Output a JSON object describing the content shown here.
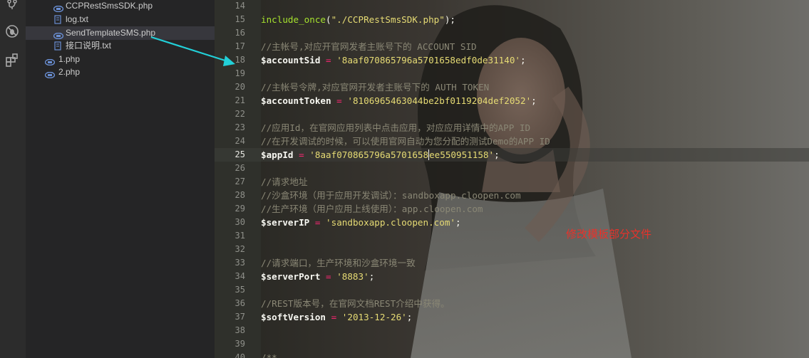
{
  "explorer": {
    "items": [
      {
        "label": "CCPRestSmsSDK.php",
        "icon": "php-file-icon",
        "selected": false
      },
      {
        "label": "log.txt",
        "icon": "text-file-icon",
        "selected": false
      },
      {
        "label": "SendTemplateSMS.php",
        "icon": "php-file-icon",
        "selected": true
      },
      {
        "label": "接口说明.txt",
        "icon": "text-file-icon",
        "selected": false
      },
      {
        "label": "1.php",
        "icon": "php-file-icon",
        "selected": false
      },
      {
        "label": "2.php",
        "icon": "php-file-icon",
        "selected": false
      }
    ]
  },
  "activity_bar": {
    "icons": [
      "source-control-icon",
      "debug-icon",
      "extensions-icon"
    ]
  },
  "editor": {
    "active_line": 25,
    "lines": [
      {
        "n": "14",
        "text": ""
      },
      {
        "n": "15",
        "tokens": [
          [
            "fn",
            "include_once"
          ],
          [
            "plain",
            "("
          ],
          [
            "str",
            "\"./CCPRestSmsSDK.php\""
          ],
          [
            "plain",
            ");"
          ]
        ]
      },
      {
        "n": "16",
        "text": ""
      },
      {
        "n": "17",
        "tokens": [
          [
            "cmt",
            "//主帐号,对应开官网发者主账号下的 ACCOUNT SID"
          ]
        ]
      },
      {
        "n": "18",
        "tokens": [
          [
            "var",
            "$accountSid"
          ],
          [
            "plain",
            " "
          ],
          [
            "op",
            "="
          ],
          [
            "plain",
            " "
          ],
          [
            "str",
            "'8aaf070865796a5701658edf0de31140'"
          ],
          [
            "plain",
            ";"
          ]
        ]
      },
      {
        "n": "19",
        "text": ""
      },
      {
        "n": "20",
        "tokens": [
          [
            "cmt",
            "//主帐号令牌,对应官网开发者主账号下的 AUTH TOKEN"
          ]
        ]
      },
      {
        "n": "21",
        "tokens": [
          [
            "var",
            "$accountToken"
          ],
          [
            "plain",
            " "
          ],
          [
            "op",
            "="
          ],
          [
            "plain",
            " "
          ],
          [
            "str",
            "'8106965463044be2bf0119204def2052'"
          ],
          [
            "plain",
            ";"
          ]
        ]
      },
      {
        "n": "22",
        "text": ""
      },
      {
        "n": "23",
        "tokens": [
          [
            "cmt",
            "//应用Id，在官网应用列表中点击应用，对应应用详情中的APP ID"
          ]
        ]
      },
      {
        "n": "24",
        "tokens": [
          [
            "cmt",
            "//在开发调试的时候，可以使用官网自动为您分配的测试Demo的APP ID"
          ]
        ]
      },
      {
        "n": "25",
        "tokens": [
          [
            "var",
            "$appId"
          ],
          [
            "plain",
            " "
          ],
          [
            "op",
            "="
          ],
          [
            "plain",
            " "
          ],
          [
            "str",
            "'8aaf070865796a5701658"
          ],
          [
            "caret",
            ""
          ],
          [
            "str",
            "ee550951158'"
          ],
          [
            "plain",
            ";"
          ]
        ]
      },
      {
        "n": "26",
        "text": ""
      },
      {
        "n": "27",
        "tokens": [
          [
            "cmt",
            "//请求地址"
          ]
        ]
      },
      {
        "n": "28",
        "tokens": [
          [
            "cmt",
            "//沙盒环境（用于应用开发调试）：sandboxapp.cloopen.com"
          ]
        ]
      },
      {
        "n": "29",
        "tokens": [
          [
            "cmt",
            "//生产环境（用户应用上线使用）：app.cloopen.com"
          ]
        ]
      },
      {
        "n": "30",
        "tokens": [
          [
            "var",
            "$serverIP"
          ],
          [
            "plain",
            " "
          ],
          [
            "op",
            "="
          ],
          [
            "plain",
            " "
          ],
          [
            "str",
            "'sandboxapp.cloopen.com'"
          ],
          [
            "plain",
            ";"
          ]
        ]
      },
      {
        "n": "31",
        "text": ""
      },
      {
        "n": "32",
        "text": ""
      },
      {
        "n": "33",
        "tokens": [
          [
            "cmt",
            "//请求端口，生产环境和沙盒环境一致"
          ]
        ]
      },
      {
        "n": "34",
        "tokens": [
          [
            "var",
            "$serverPort"
          ],
          [
            "plain",
            " "
          ],
          [
            "op",
            "="
          ],
          [
            "plain",
            " "
          ],
          [
            "str",
            "'8883'"
          ],
          [
            "plain",
            ";"
          ]
        ]
      },
      {
        "n": "35",
        "text": ""
      },
      {
        "n": "36",
        "tokens": [
          [
            "cmt",
            "//REST版本号，在官网文档REST介绍中获得。"
          ]
        ]
      },
      {
        "n": "37",
        "tokens": [
          [
            "var",
            "$softVersion"
          ],
          [
            "plain",
            " "
          ],
          [
            "op",
            "="
          ],
          [
            "plain",
            " "
          ],
          [
            "str",
            "'2013-12-26'"
          ],
          [
            "plain",
            ";"
          ]
        ]
      },
      {
        "n": "38",
        "text": ""
      },
      {
        "n": "39",
        "text": ""
      },
      {
        "n": "40",
        "tokens": [
          [
            "cmt",
            "/**"
          ]
        ]
      }
    ]
  },
  "annotation": {
    "text": "修改模板部分文件",
    "color": "#e8322b"
  },
  "arrow_color": "#22d0d8",
  "theme": {
    "keyword": "#f92672",
    "string": "#e6db74",
    "function": "#a6e22e",
    "comment": "#8a8775"
  }
}
